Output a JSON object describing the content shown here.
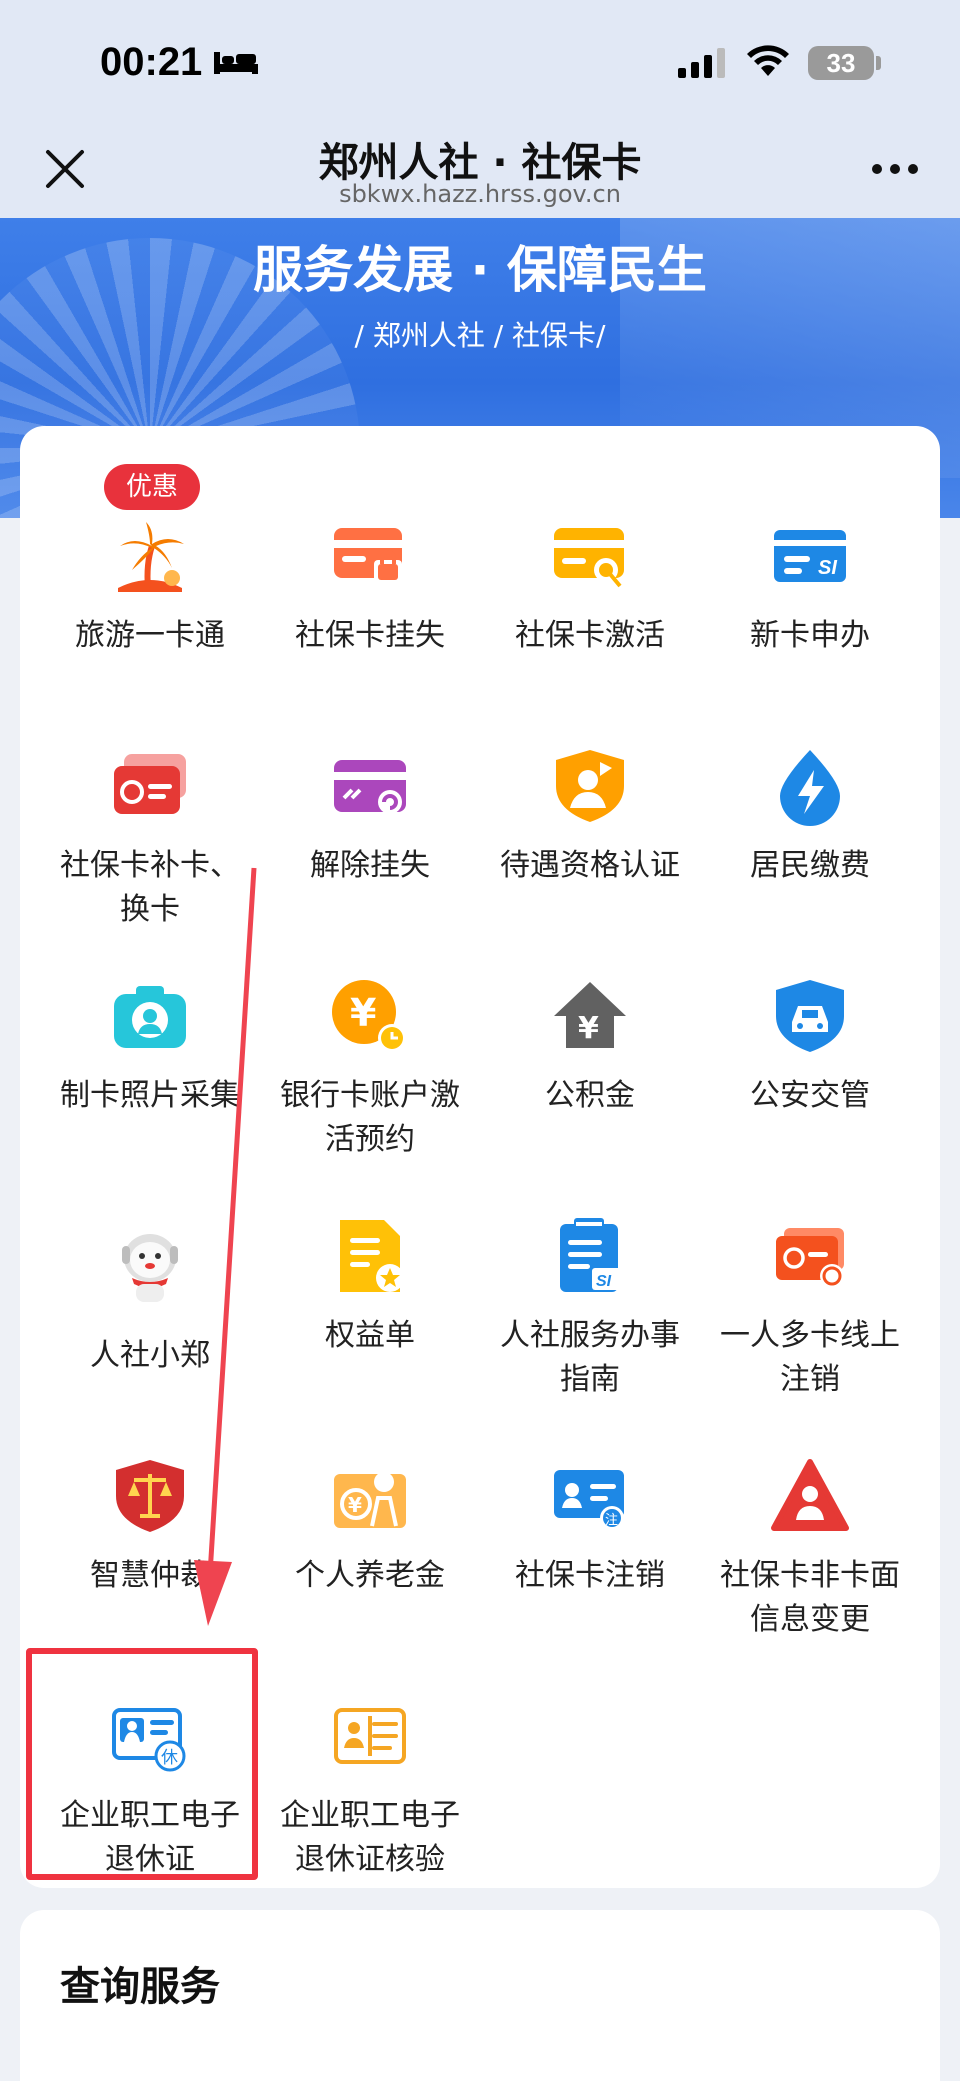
{
  "status": {
    "time": "00:21",
    "battery": "33"
  },
  "header": {
    "title": "郑州人社 · 社保卡",
    "url": "sbkwx.hazz.hrss.gov.cn"
  },
  "banner": {
    "title": "服务发展 · 保障民生",
    "subtitle": "/ 郑州人社 / 社保卡/"
  },
  "badge": "优惠",
  "services": [
    {
      "label": "旅游一卡通",
      "icon": "palm-tree-icon"
    },
    {
      "label": "社保卡挂失",
      "icon": "card-lock-icon"
    },
    {
      "label": "社保卡激活",
      "icon": "card-activate-icon"
    },
    {
      "label": "新卡申办",
      "icon": "new-card-icon"
    },
    {
      "label": "社保卡补卡、\n换卡",
      "icon": "card-replace-icon"
    },
    {
      "label": "解除挂失",
      "icon": "card-unlock-icon"
    },
    {
      "label": "待遇资格认证",
      "icon": "shield-person-icon"
    },
    {
      "label": "居民缴费",
      "icon": "lightning-drop-icon"
    },
    {
      "label": "制卡照片采集",
      "icon": "camera-icon"
    },
    {
      "label": "银行卡账户激\n活预约",
      "icon": "yuan-clock-icon"
    },
    {
      "label": "公积金",
      "icon": "house-yuan-icon"
    },
    {
      "label": "公安交管",
      "icon": "police-car-icon"
    },
    {
      "label": "人社小郑",
      "icon": "mascot-icon"
    },
    {
      "label": "权益单",
      "icon": "document-star-icon"
    },
    {
      "label": "人社服务办事\n指南",
      "icon": "clipboard-guide-icon"
    },
    {
      "label": "一人多卡线上\n注销",
      "icon": "multi-card-icon"
    },
    {
      "label": "智慧仲裁",
      "icon": "scales-shield-icon"
    },
    {
      "label": "个人养老金",
      "icon": "pension-icon"
    },
    {
      "label": "社保卡注销",
      "icon": "card-cancel-icon"
    },
    {
      "label": "社保卡非卡面\n信息变更",
      "icon": "warning-person-icon"
    },
    {
      "label": "企业职工电子\n退休证",
      "icon": "retirement-card-icon"
    },
    {
      "label": "企业职工电子\n退休证核验",
      "icon": "id-verify-icon"
    }
  ],
  "query_section": {
    "title": "查询服务"
  },
  "colors": {
    "accent": "#2f6fe0",
    "highlight": "#ef3340"
  }
}
